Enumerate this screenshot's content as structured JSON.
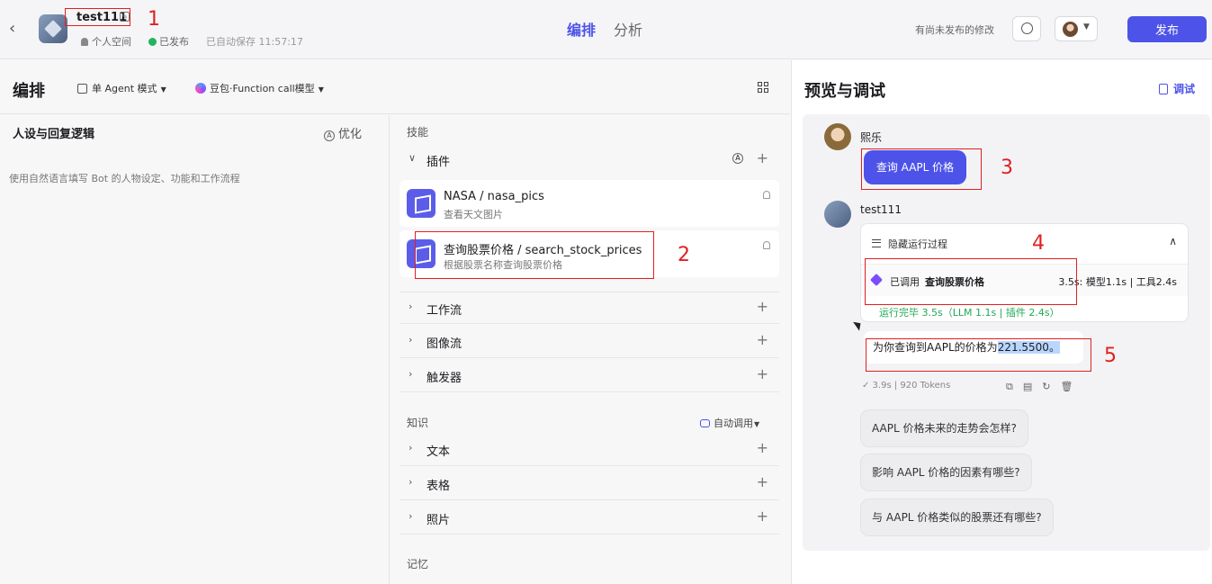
{
  "header": {
    "bot_name": "test111",
    "space": "个人空间",
    "status": "已发布",
    "autosave": "已自动保存 11:57:17",
    "tabs": [
      "编排",
      "分析"
    ],
    "unpublished_note": "有尚未发布的修改",
    "publish_label": "发布"
  },
  "edit": {
    "title": "编排",
    "mode": "单 Agent 模式",
    "model": "豆包·Function call模型"
  },
  "persona": {
    "title": "人设与回复逻辑",
    "optimize": "优化",
    "placeholder": "使用自然语言填写 Bot 的人物设定、功能和工作流程"
  },
  "skills": {
    "title": "技能",
    "plugins_label": "插件",
    "plugins": [
      {
        "name": "NASA / nasa_pics",
        "desc": "查看天文图片"
      },
      {
        "name": "查询股票价格 / search_stock_prices",
        "desc": "根据股票名称查询股票价格"
      }
    ],
    "workflow_label": "工作流",
    "imageflow_label": "图像流",
    "trigger_label": "触发器",
    "knowledge_title": "知识",
    "auto_call": "自动调用",
    "text_label": "文本",
    "table_label": "表格",
    "photo_label": "照片",
    "memory_title": "记忆"
  },
  "preview": {
    "title": "预览与调试",
    "debug_label": "调试",
    "user_name": "熙乐",
    "user_message": "查询  AAPL 价格",
    "bot_name": "test111",
    "hide_process": "隐藏运行过程",
    "called_prefix": "已调用",
    "called_tool": "查询股票价格",
    "called_time": "3.5s: 模型1.1s | 工具2.4s",
    "run_done": "运行完毕 3.5s（LLM 1.1s | 插件 2.4s）",
    "reply_prefix": "为你查询到AAPL的价格为",
    "reply_value": "221.5500。",
    "reply_meta": "✓ 3.9s  |  920 Tokens",
    "suggestions": [
      "AAPL 价格未来的走势会怎样?",
      "影响 AAPL 价格的因素有哪些?",
      "与 AAPL 价格类似的股票还有哪些?"
    ]
  },
  "annotations": [
    "1",
    "2",
    "3",
    "4",
    "5"
  ],
  "colors": {
    "accent": "#4d53e8",
    "annotation": "#e02020",
    "success": "#22a855"
  }
}
